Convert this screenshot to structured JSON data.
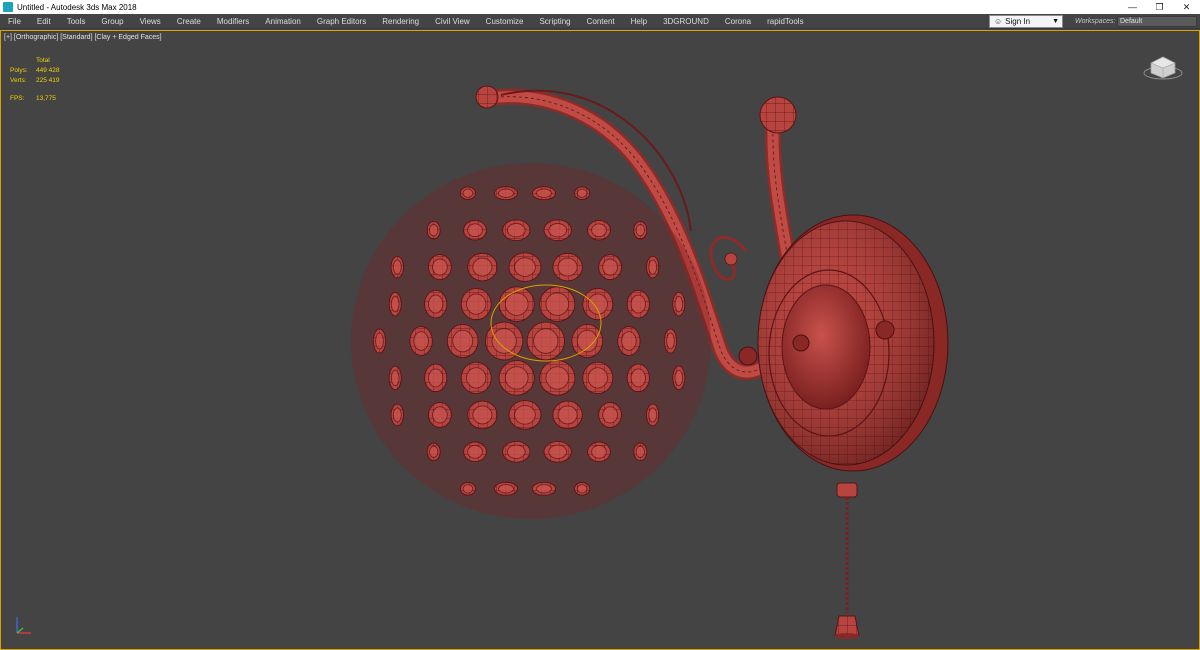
{
  "window": {
    "title": "Untitled - Autodesk 3ds Max 2018",
    "controls": {
      "minimize": "—",
      "maximize": "❐",
      "close": "✕"
    }
  },
  "menu": [
    "File",
    "Edit",
    "Tools",
    "Group",
    "Views",
    "Create",
    "Modifiers",
    "Animation",
    "Graph Editors",
    "Rendering",
    "Civil View",
    "Customize",
    "Scripting",
    "Content",
    "Help",
    "3DGROUND",
    "Corona",
    "rapidTools"
  ],
  "signin": {
    "label": "Sign In"
  },
  "workspaces": {
    "label": "Workspaces:",
    "value": "Default"
  },
  "viewport": {
    "label": "[+] [Orthographic] [Standard] [Clay + Edged Faces]",
    "stats": {
      "total_label": "Total",
      "polys_label": "Polys:",
      "polys_value": "449 428",
      "verts_label": "Verts:",
      "verts_value": "225 419",
      "fps_label": "FPS:",
      "fps_value": "13,775"
    }
  },
  "colors": {
    "viewport_bg": "#444444",
    "active_border": "#d9a200",
    "stats_text": "#f0d300",
    "model_clay": "#b8443f",
    "model_wire": "#5a1416"
  },
  "icons": {
    "app": "3ds-max-app-icon",
    "user": "user-icon",
    "dropdown": "chevron-down-icon",
    "viewcube": "viewcube-icon",
    "axis": "axis-tripod-icon"
  }
}
